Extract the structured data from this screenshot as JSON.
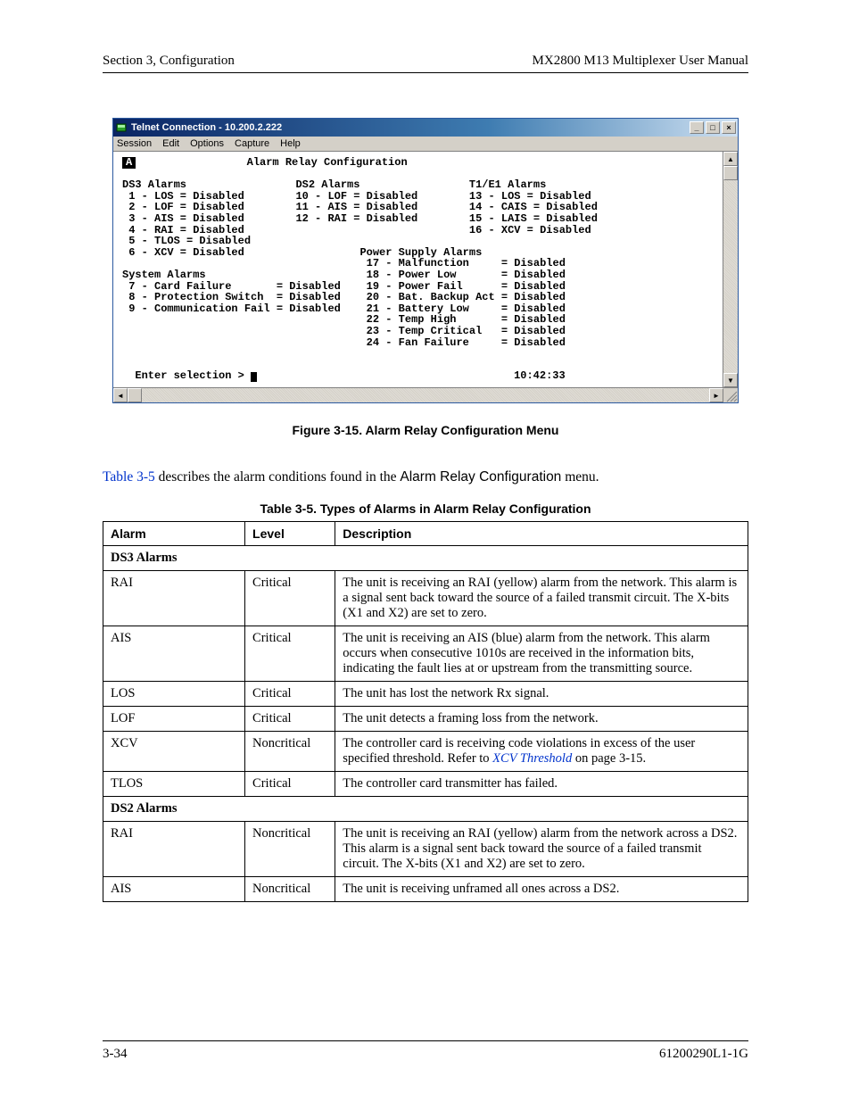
{
  "header": {
    "left": "Section 3, Configuration",
    "right": "MX2800 M13 Multiplexer User Manual"
  },
  "footer": {
    "left": "3-34",
    "right": "61200290L1-1G"
  },
  "window": {
    "title": "Telnet Connection - 10.200.2.222",
    "menus": [
      "Session",
      "Edit",
      "Options",
      "Capture",
      "Help"
    ],
    "ctrl_min": "_",
    "ctrl_max": "□",
    "ctrl_close": "×",
    "scroll_up": "▲",
    "scroll_down": "▼",
    "scroll_left": "◄",
    "scroll_right": "►"
  },
  "terminal": {
    "a_label": "A",
    "heading": "Alarm Relay Configuration",
    "prompt": "  Enter selection > ",
    "clock": "10:42:33",
    "ds3_title": "DS3 Alarms",
    "ds3": [
      " 1 - LOS = Disabled",
      " 2 - LOF = Disabled",
      " 3 - AIS = Disabled",
      " 4 - RAI = Disabled",
      " 5 - TLOS = Disabled",
      " 6 - XCV = Disabled"
    ],
    "sys_title": "System Alarms",
    "sys": [
      " 7 - Card Failure       = Disabled",
      " 8 - Protection Switch  = Disabled",
      " 9 - Communication Fail = Disabled"
    ],
    "ds2_title": "DS2 Alarms",
    "ds2": [
      "10 - LOF = Disabled",
      "11 - AIS = Disabled",
      "12 - RAI = Disabled"
    ],
    "t1_title": "T1/E1 Alarms",
    "t1": [
      "13 - LOS = Disabled",
      "14 - CAIS = Disabled",
      "15 - LAIS = Disabled",
      "16 - XCV = Disabled"
    ],
    "ps_title": "Power Supply Alarms",
    "ps": [
      "17 - Malfunction     = Disabled",
      "18 - Power Low       = Disabled",
      "19 - Power Fail      = Disabled",
      "20 - Bat. Backup Act = Disabled",
      "21 - Battery Low     = Disabled",
      "22 - Temp High       = Disabled",
      "23 - Temp Critical   = Disabled",
      "24 - Fan Failure     = Disabled"
    ]
  },
  "figure_caption": "Figure 3-15.   Alarm Relay Configuration Menu",
  "paragraph": {
    "lead_link": "Table 3-5",
    "rest1": " describes the alarm conditions found in the ",
    "menu_name": "Alarm Relay Configuration",
    "rest2": " menu."
  },
  "table_caption": "Table 3-5.  Types of Alarms in Alarm Relay Configuration",
  "tbl": {
    "h1": "Alarm",
    "h2": "Level",
    "h3": "Description",
    "s1": "DS3 Alarms",
    "r1": {
      "a": "RAI",
      "l": "Critical",
      "d": "The unit is receiving an RAI (yellow) alarm from the network. This alarm is a signal sent back toward the source of a failed transmit circuit. The X-bits (X1 and X2) are set to zero."
    },
    "r2": {
      "a": "AIS",
      "l": "Critical",
      "d": "The unit is receiving an AIS (blue) alarm from the network. This alarm occurs when consecutive 1010s are received in the information bits, indicating the fault lies at or upstream from the transmitting source."
    },
    "r3": {
      "a": "LOS",
      "l": "Critical",
      "d": "The unit has lost the network Rx signal."
    },
    "r4": {
      "a": "LOF",
      "l": "Critical",
      "d": "The unit detects a framing loss from the network."
    },
    "r5": {
      "a": "XCV",
      "l": "Noncritical",
      "d1": "The controller card is receiving code violations in excess of the user specified threshold. Refer to ",
      "link": "XCV Threshold",
      "d2": " on page 3-15."
    },
    "r6": {
      "a": "TLOS",
      "l": "Critical",
      "d": "The controller card transmitter has failed."
    },
    "s2": "DS2 Alarms",
    "r7": {
      "a": "RAI",
      "l": "Noncritical",
      "d": "The unit is receiving an RAI (yellow) alarm from the network across a DS2. This alarm is a signal sent back toward the source of a failed transmit circuit. The X-bits (X1 and X2) are set to zero."
    },
    "r8": {
      "a": "AIS",
      "l": "Noncritical",
      "d": "The unit is receiving unframed all ones across a DS2."
    }
  }
}
